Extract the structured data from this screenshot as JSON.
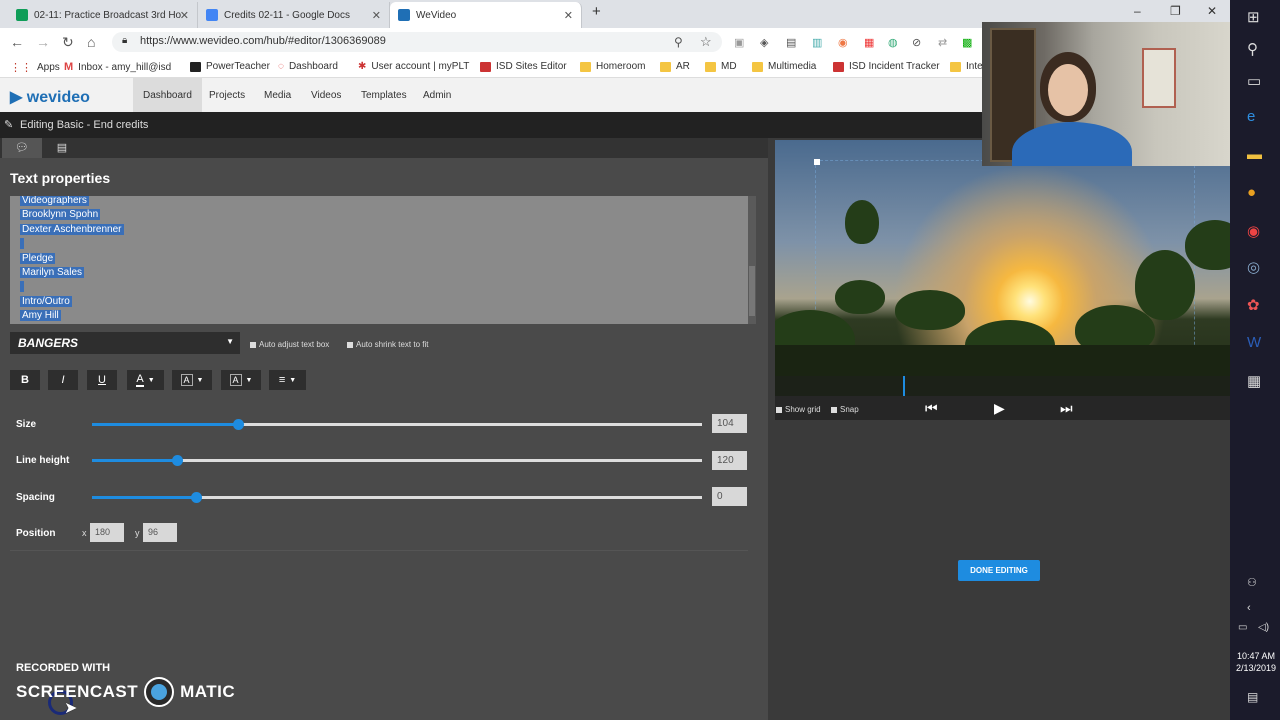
{
  "browser": {
    "tabs": [
      {
        "title": "02-11: Practice Broadcast 3rd Ho",
        "icon": "drive-icon",
        "color": "#0f9d58"
      },
      {
        "title": "Credits 02-11 - Google Docs",
        "icon": "docs-icon",
        "color": "#4285f4"
      },
      {
        "title": "WeVideo",
        "icon": "wevideo-icon",
        "color": "#1f6fb5"
      }
    ],
    "new_tab": "+",
    "url": "https://www.wevideo.com/hub/#editor/1306369089",
    "bookmarks": [
      "Apps",
      "Inbox - amy_hill@isd",
      "PowerTeacher",
      "Dashboard",
      "User account | myPLT",
      "ISD Sites Editor",
      "Homeroom",
      "AR",
      "MD",
      "Multimedia",
      "ISD Incident Tracker",
      "Inte"
    ]
  },
  "app": {
    "logo": "wevideo",
    "nav": [
      "Dashboard",
      "Projects",
      "Media",
      "Videos",
      "Templates",
      "Admin"
    ],
    "editing_title": "Editing Basic - End credits"
  },
  "text_properties": {
    "title": "Text properties",
    "lines": [
      "Videographers",
      "Brooklynn Spohn",
      "Dexter Aschenbrenner",
      "",
      "Pledge",
      "Marilyn Sales",
      "",
      "Intro/Outro",
      "Amy Hill"
    ],
    "font": "BANGERS",
    "auto_adjust": "Auto adjust text box",
    "auto_shrink": "Auto shrink text to fit",
    "format_buttons": {
      "bold": "B",
      "italic": "I",
      "underline": "U",
      "color": "A",
      "bg": "A",
      "outline": "A",
      "align": "≡"
    },
    "size_label": "Size",
    "size_value": "104",
    "size_fraction": 0.24,
    "line_height_label": "Line height",
    "line_height_value": "120",
    "line_height_fraction": 0.14,
    "spacing_label": "Spacing",
    "spacing_value": "0",
    "spacing_fraction": 0.17,
    "position_label": "Position",
    "x_label": "x",
    "x_value": "180",
    "y_label": "y",
    "y_value": "96"
  },
  "preview": {
    "show_grid": "Show grid",
    "snap": "Snap",
    "done": "DONE EDITING"
  },
  "watermark": {
    "recorded": "RECORDED WITH",
    "screencast": "SCREENCAST",
    "matic": "MATIC"
  },
  "taskbar": {
    "time": "10:47 AM",
    "date": "2/13/2019"
  }
}
